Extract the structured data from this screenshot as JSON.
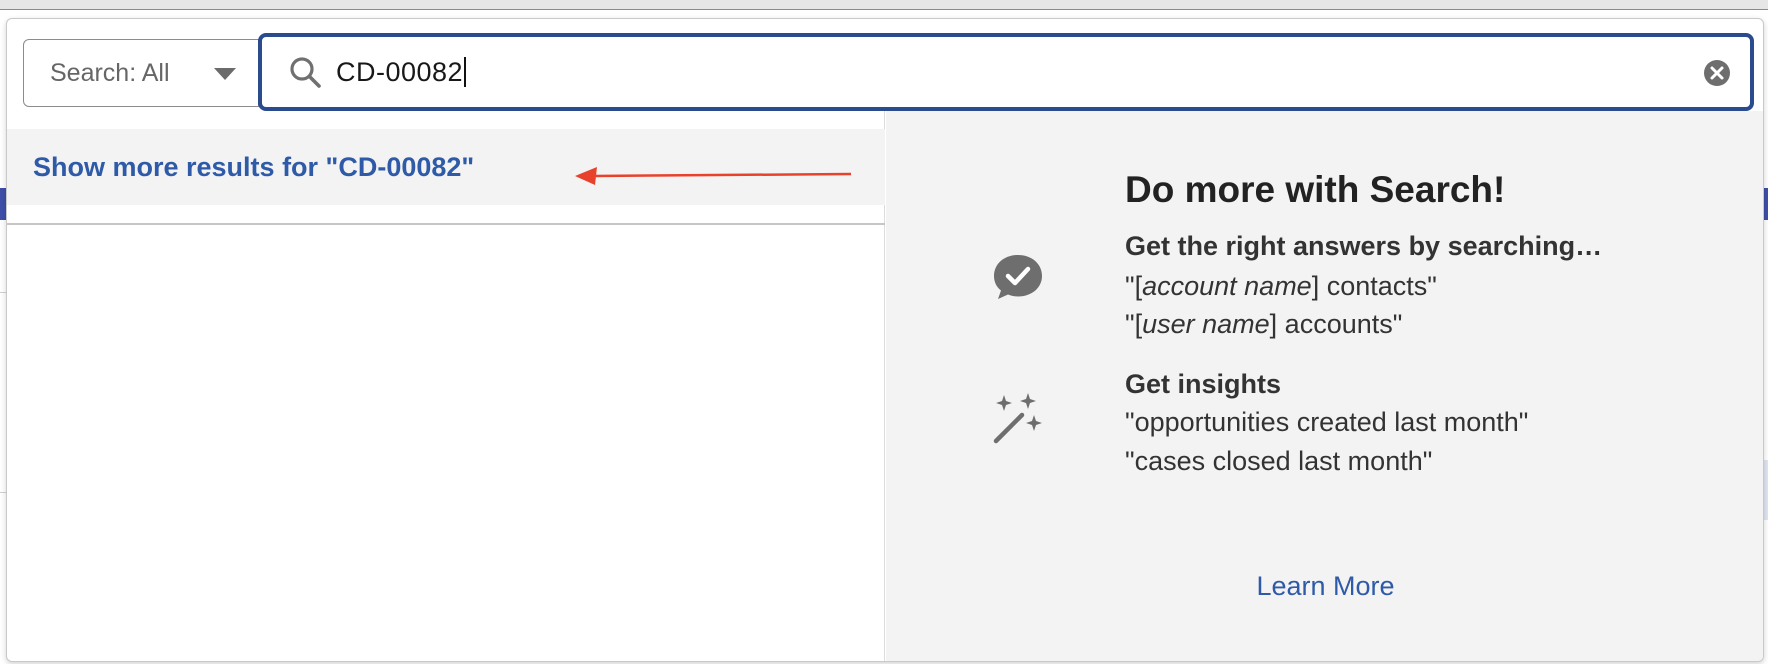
{
  "search": {
    "scope_label": "Search: All",
    "query": "CD-00082"
  },
  "results": {
    "show_more_label": "Show more results for \"CD-00082\""
  },
  "tips": {
    "title": "Do more with Search!",
    "section1": {
      "heading": "Get the right answers by searching…",
      "line1": {
        "pre": "\"[",
        "em": "account name",
        "post": "] contacts\""
      },
      "line2": {
        "pre": "\"[",
        "em": "user name",
        "post": "] accounts\""
      },
      "icon": "chat-check-icon"
    },
    "section2": {
      "heading": "Get insights",
      "line1": "\"opportunities created last month\"",
      "line2": "\"cases closed last month\"",
      "icon": "magic-wand-icon"
    },
    "learn_more": "Learn More"
  },
  "colors": {
    "accent_blue": "#2e5aa7",
    "search_border": "#2b4b8f",
    "annotation_arrow": "#e8412c"
  }
}
